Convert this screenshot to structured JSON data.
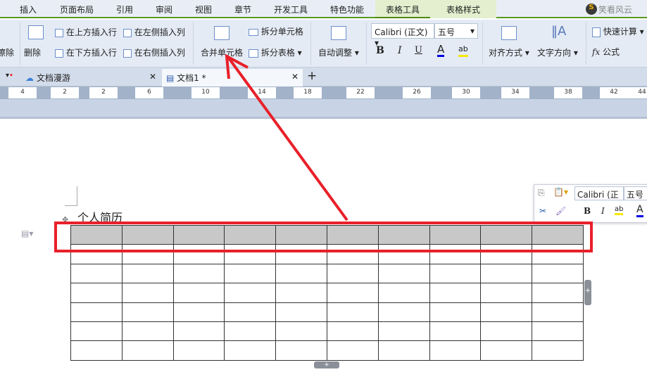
{
  "menu": {
    "tabs": [
      "插入",
      "页面布局",
      "引用",
      "审阅",
      "视图",
      "章节",
      "开发工具",
      "特色功能"
    ],
    "context_tabs": [
      "表格工具",
      "表格样式"
    ],
    "active": "表格工具",
    "user": "笑看风云"
  },
  "ribbon": {
    "erase": "擦除",
    "delete": "删除",
    "insert_above": "在上方插入行",
    "insert_below": "在下方插入行",
    "insert_left": "在左侧插入列",
    "insert_right": "在右侧插入列",
    "merge_cells": "合并单元格",
    "split_cells": "拆分单元格",
    "split_table": "拆分表格",
    "autofit": "自动调整",
    "font": "Calibri (正文)",
    "size": "五号",
    "bold": "B",
    "italic": "I",
    "underline": "U",
    "font_color": "A",
    "highlight": "ab",
    "align": "对齐方式",
    "text_direction": "文字方向",
    "quick_calc": "快速计算",
    "formula_fx": "fx",
    "formula": "公式"
  },
  "doc_tabs": [
    {
      "label": "文档漫游"
    },
    {
      "label": "文档1 *",
      "active": true
    }
  ],
  "ruler": [
    "4",
    "2",
    "2",
    "6",
    "10",
    "14",
    "18",
    "22",
    "26",
    "30",
    "34",
    "38",
    "42",
    "44"
  ],
  "document": {
    "heading": "个人简历",
    "table_rows": 7,
    "table_cols": 10
  },
  "mini_toolbar": {
    "font": "Calibri (正",
    "size": "五号",
    "bold": "B",
    "italic": "I",
    "highlight": "ab",
    "font_color": "A"
  },
  "colors": {
    "accent_green": "#5b9a1f",
    "annotation_red": "#e8202a",
    "header_fill": "#c8c8c8"
  }
}
